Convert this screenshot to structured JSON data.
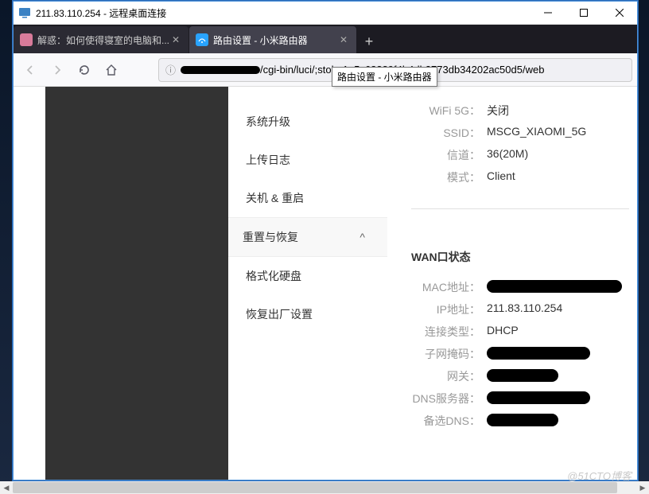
{
  "window": {
    "title": "211.83.110.254 - 远程桌面连接"
  },
  "tabs": [
    {
      "title": "解惑：如何使得寝室的电脑和...",
      "active": false
    },
    {
      "title": "路由设置 - 小米路由器",
      "active": true
    }
  ],
  "tooltip": "路由设置 - 小米路由器",
  "urlbar": {
    "value": "/cgi-bin/luci/;stok=1a5c68889f4b4db2773db34202ac50d5/web",
    "prefix_redacted": true
  },
  "menu": {
    "items": [
      "系统升级",
      "上传日志",
      "关机 & 重启"
    ],
    "section": "重置与恢复",
    "sub_items": [
      "格式化硬盘",
      "恢复出厂设置"
    ]
  },
  "wifi5g": {
    "status_label": "WiFi 5G：",
    "status_value": "关闭",
    "ssid_label": "SSID：",
    "ssid_value": "MSCG_XIAOMI_5G",
    "channel_label": "信道：",
    "channel_value": "36(20M)",
    "mode_label": "模式：",
    "mode_value": "Client"
  },
  "wan": {
    "title": "WAN口状态",
    "mac_label": "MAC地址：",
    "ip_label": "IP地址：",
    "ip_value": "211.83.110.254",
    "conn_label": "连接类型：",
    "conn_value": "DHCP",
    "mask_label": "子网掩码：",
    "gw_label": "网关：",
    "dns_label": "DNS服务器：",
    "dns2_label": "备选DNS："
  },
  "watermark": "@51CTO博客"
}
